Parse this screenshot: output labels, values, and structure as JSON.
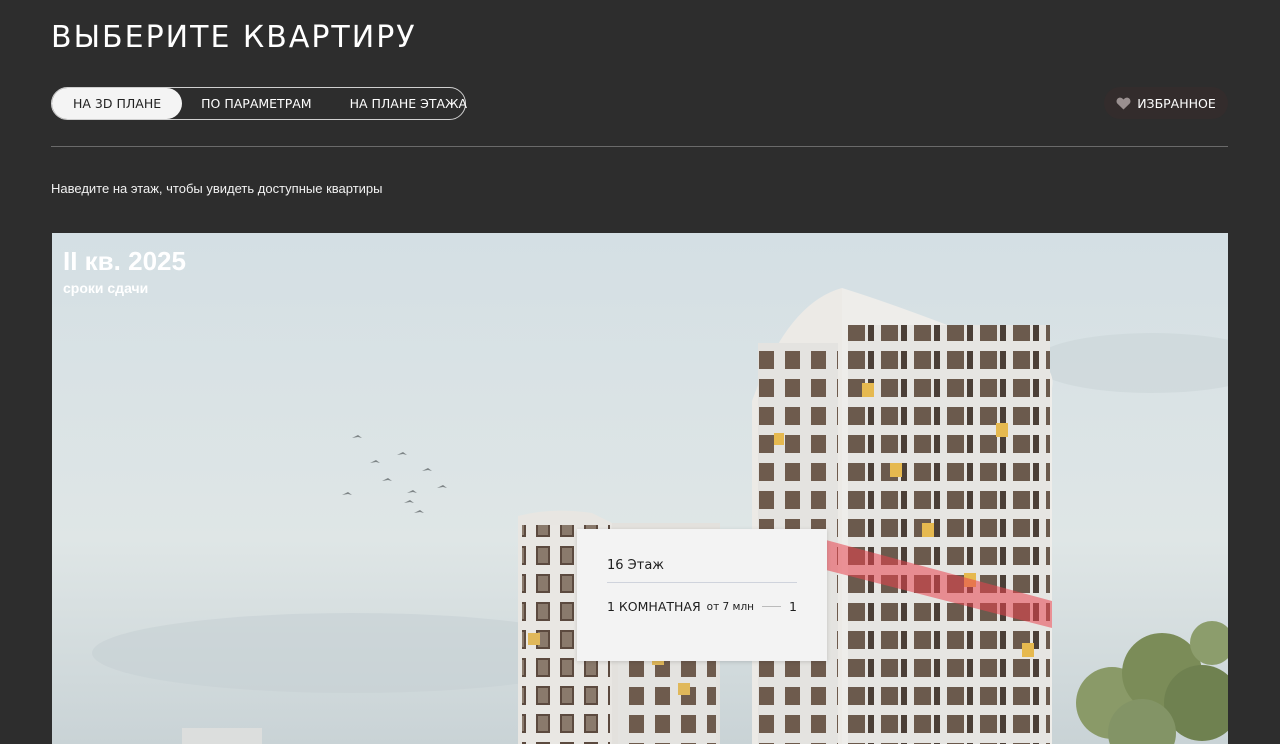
{
  "page": {
    "title": "ВЫБЕРИТЕ КВАРТИРУ",
    "hint": "Наведите на этаж, чтобы увидеть доступные квартиры"
  },
  "mode_tabs": [
    {
      "label": "НА 3D ПЛАНЕ",
      "active": true
    },
    {
      "label": "ПО ПАРАМЕТРАМ",
      "active": false
    },
    {
      "label": "НА ПЛАНЕ ЭТАЖА",
      "active": false
    }
  ],
  "favorites": {
    "label": "ИЗБРАННОЕ",
    "icon": "heart-icon"
  },
  "scene": {
    "deadline_value": "II кв. 2025",
    "deadline_label": "сроки сдачи",
    "highlight_color": "#e8434f"
  },
  "tooltip": {
    "floor": "16 Этаж",
    "rows": [
      {
        "rooms": "1 КОМНАТНАЯ",
        "price": "от 7 млн",
        "count": "1"
      }
    ]
  },
  "colors": {
    "background": "#2d2d2d",
    "tab_active_bg": "#f4f4f4",
    "favorites_bg": "#332c2c"
  }
}
